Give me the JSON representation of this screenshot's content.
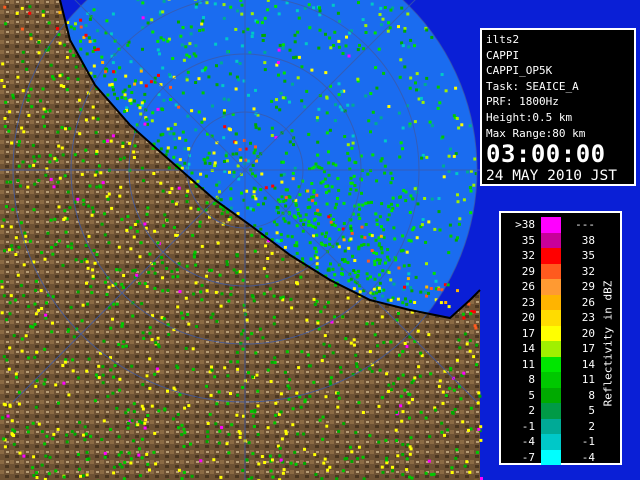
{
  "info": {
    "site": "ilts2",
    "product": "CAPPI",
    "product_id": "CAPPI_OP5K",
    "task": "Task: SEAICE_A",
    "prf": "PRF: 1800Hz",
    "height": "Height:0.5 km",
    "max_range": "Max Range:80 km",
    "time": "03:00:00",
    "date": "24 MAY 2010 JST"
  },
  "legend": {
    "unit": "Reflectivity in dBZ",
    "bins": [
      {
        "low": ">38",
        "high": "---",
        "color": "#ff00ff"
      },
      {
        "low": "35",
        "high": "38",
        "color": "#c8009a"
      },
      {
        "low": "32",
        "high": "35",
        "color": "#ff0000"
      },
      {
        "low": "29",
        "high": "32",
        "color": "#ff5a1e"
      },
      {
        "low": "26",
        "high": "29",
        "color": "#ff9a32"
      },
      {
        "low": "23",
        "high": "26",
        "color": "#ffb400"
      },
      {
        "low": "20",
        "high": "23",
        "color": "#ffdc00"
      },
      {
        "low": "17",
        "high": "20",
        "color": "#ffff00"
      },
      {
        "low": "14",
        "high": "17",
        "color": "#a0f000"
      },
      {
        "low": "11",
        "high": "14",
        "color": "#00e600"
      },
      {
        "low": "8",
        "high": "11",
        "color": "#00c800"
      },
      {
        "low": "5",
        "high": "8",
        "color": "#00aa00"
      },
      {
        "low": "2",
        "high": "5",
        "color": "#009a46"
      },
      {
        "low": "-1",
        "high": "2",
        "color": "#00aa96"
      },
      {
        "low": "-4",
        "high": "-1",
        "color": "#00c8c8"
      },
      {
        "low": "-7",
        "high": "-4",
        "color": "#00ffff"
      }
    ]
  },
  "colors": {
    "sea": "#0a1fd6",
    "radar_coverage": "#1a6cf0",
    "land": "#7a5c3a",
    "range_ring": "#3c5aa8"
  }
}
